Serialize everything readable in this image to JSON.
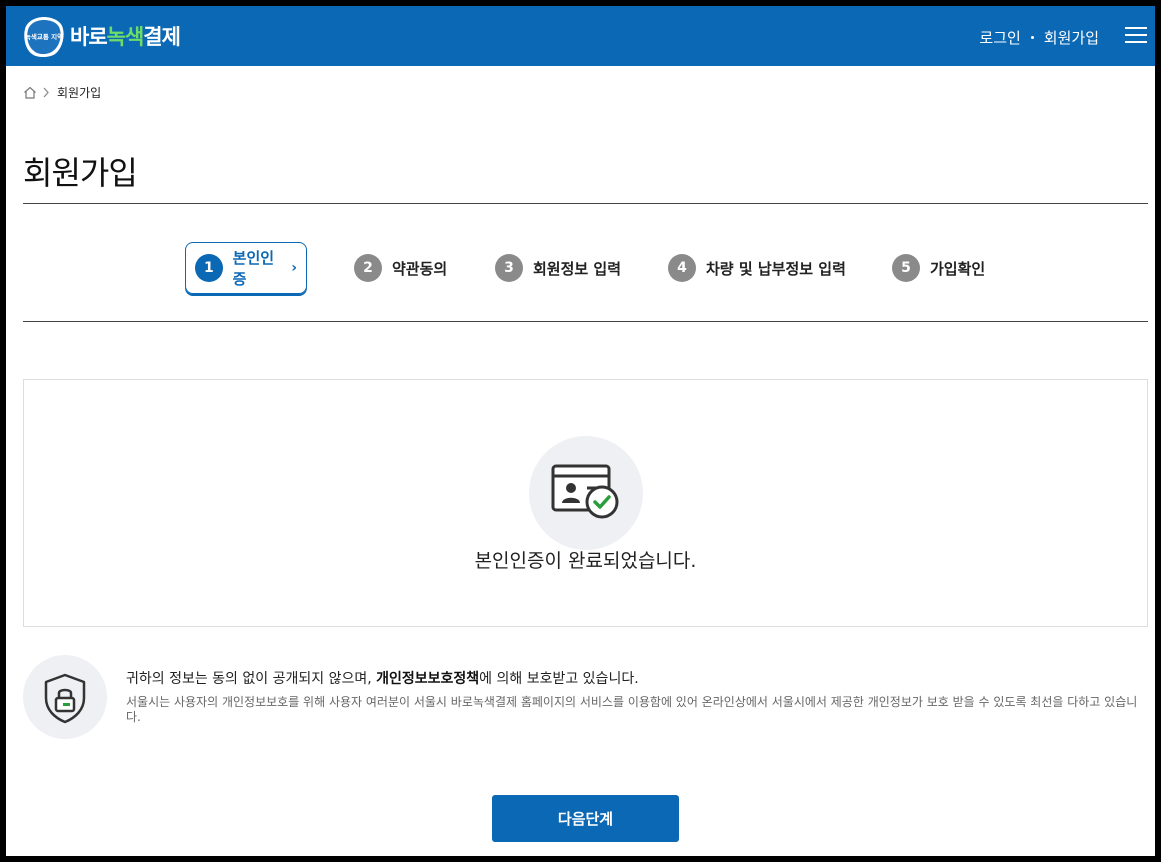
{
  "header": {
    "logo_badge_text": "녹색교통 지역",
    "brand_part1": "바로",
    "brand_part2": "녹색",
    "brand_part3": "결제",
    "login_label": "로그인",
    "signup_label": "회원가입",
    "menu_icon": "hamburger-menu-icon",
    "colors": {
      "primary": "#0b68b4",
      "brand_green": "#6fdc6a"
    }
  },
  "breadcrumb": {
    "home_icon": "home-icon",
    "current": "회원가입"
  },
  "page": {
    "title": "회원가입"
  },
  "steps": [
    {
      "number": "1",
      "label": "본인인증",
      "active": true
    },
    {
      "number": "2",
      "label": "약관동의",
      "active": false
    },
    {
      "number": "3",
      "label": "회원정보 입력",
      "active": false
    },
    {
      "number": "4",
      "label": "차량 및 납부정보 입력",
      "active": false
    },
    {
      "number": "5",
      "label": "가입확인",
      "active": false
    }
  ],
  "verification": {
    "icon": "id-card-check-icon",
    "message": "본인인증이 완료되었습니다."
  },
  "privacy": {
    "icon": "shield-lock-icon",
    "main_before": "귀하의 정보는 동의 없이 공개되지 않으며, ",
    "main_bold": "개인정보보호정책",
    "main_after": "에 의해 보호받고 있습니다.",
    "sub": "서울시는 사용자의 개인정보보호를 위해 사용자 여러분이 서울시 바로녹색결제 홈페이지의 서비스를 이용함에 있어 온라인상에서 서울시에서 제공한 개인정보가 보호 받을 수 있도록 최선을 다하고 있습니다."
  },
  "actions": {
    "next_label": "다음단계"
  }
}
